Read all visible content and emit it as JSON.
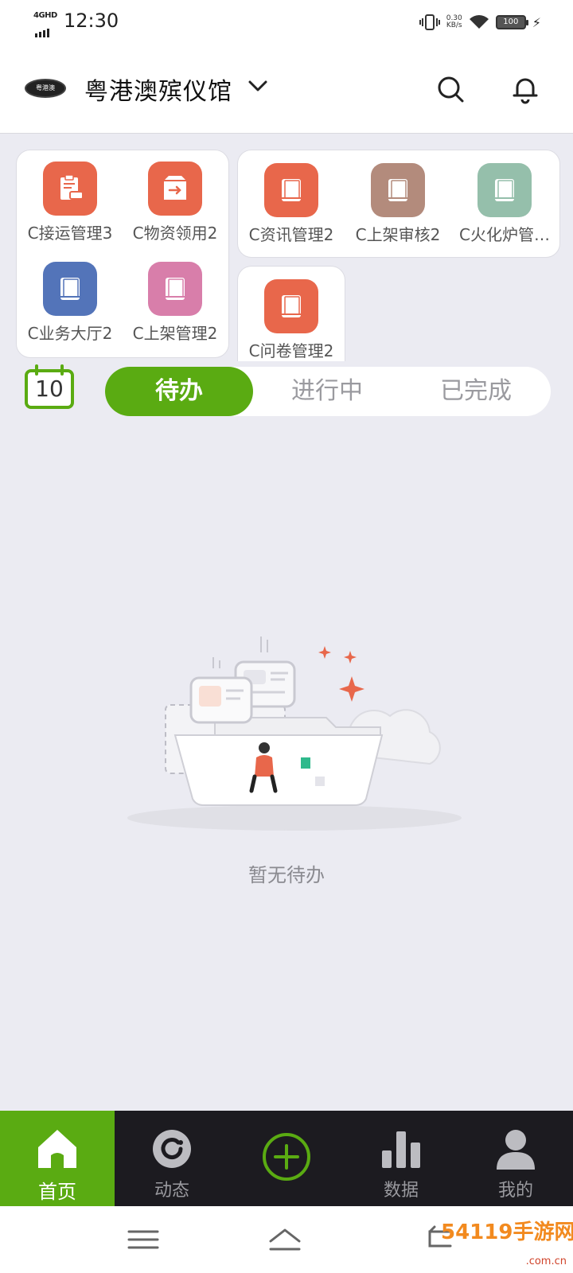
{
  "status_bar": {
    "network": "4GHD",
    "time": "12:30",
    "speed_value": "0.30",
    "speed_unit": "KB/s",
    "battery": "100"
  },
  "header": {
    "org_name": "粤港澳殡仪馆",
    "logo_text": "粤港澳"
  },
  "apps_left": [
    {
      "label": "C接运管理3",
      "color": "#e8674b",
      "icon": "clipboard-car-icon"
    },
    {
      "label": "C物资领用2",
      "color": "#e8674b",
      "icon": "box-arrow-icon"
    },
    {
      "label": "C业务大厅2",
      "color": "#5374b9",
      "icon": "book-icon"
    },
    {
      "label": "C上架管理2",
      "color": "#d87eaa",
      "icon": "book-icon"
    }
  ],
  "apps_right": [
    {
      "label": "C资讯管理2",
      "color": "#e8674b",
      "icon": "book-icon"
    },
    {
      "label": "C上架审核2",
      "color": "#b38b7c",
      "icon": "book-icon"
    },
    {
      "label": "C火化炉管…",
      "color": "#95bfab",
      "icon": "book-icon"
    }
  ],
  "apps_single": [
    {
      "label": "C问卷管理2",
      "color": "#e8674b",
      "icon": "book-icon"
    }
  ],
  "calendar": {
    "day": "10"
  },
  "tabs": [
    {
      "label": "待办",
      "active": true
    },
    {
      "label": "进行中",
      "active": false
    },
    {
      "label": "已完成",
      "active": false
    }
  ],
  "empty_state": {
    "text": "暂无待办"
  },
  "bottom_nav": [
    {
      "label": "首页",
      "icon": "home-icon",
      "active": true
    },
    {
      "label": "动态",
      "icon": "activity-icon",
      "active": false
    },
    {
      "label": "",
      "icon": "add-icon",
      "active": false
    },
    {
      "label": "数据",
      "icon": "bar-chart-icon",
      "active": false
    },
    {
      "label": "我的",
      "icon": "user-icon",
      "active": false
    }
  ],
  "colors": {
    "accent": "#5aab12",
    "nav_bg": "#1c1b20",
    "page_bg": "#ebebf2"
  },
  "watermark": {
    "text": "54119手游网",
    "sub": ".com.cn"
  }
}
